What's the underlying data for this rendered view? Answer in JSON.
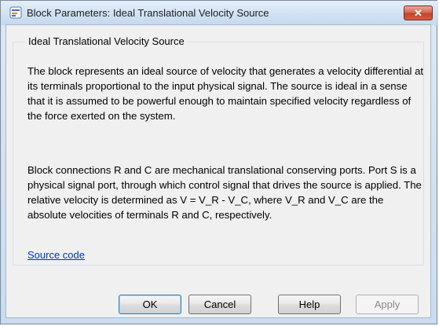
{
  "window": {
    "title": "Block Parameters: Ideal Translational Velocity Source",
    "close_label": "✕"
  },
  "block": {
    "group_title": "Ideal Translational Velocity Source",
    "description_1": "The block represents an ideal source of velocity that generates a velocity differential at its terminals proportional to the input physical signal. The source is ideal in a sense that it is assumed to be powerful enough to maintain specified velocity regardless of the force exerted on the system.",
    "description_2": "Block connections R and C are mechanical translational conserving ports. Port S is a physical signal port, through which control signal that drives the source is applied. The relative velocity is determined as V = V_R - V_C, where V_R and V_C are the absolute velocities of terminals R and C, respectively.",
    "source_link": "Source code"
  },
  "buttons": {
    "ok": "OK",
    "cancel": "Cancel",
    "help": "Help",
    "apply": "Apply"
  },
  "icons": {
    "app": "block-parameters-icon",
    "close": "close-icon"
  },
  "colors": {
    "link": "#0033cc",
    "close_button": "#c0442c",
    "title_bar": "#d3e3f4"
  }
}
